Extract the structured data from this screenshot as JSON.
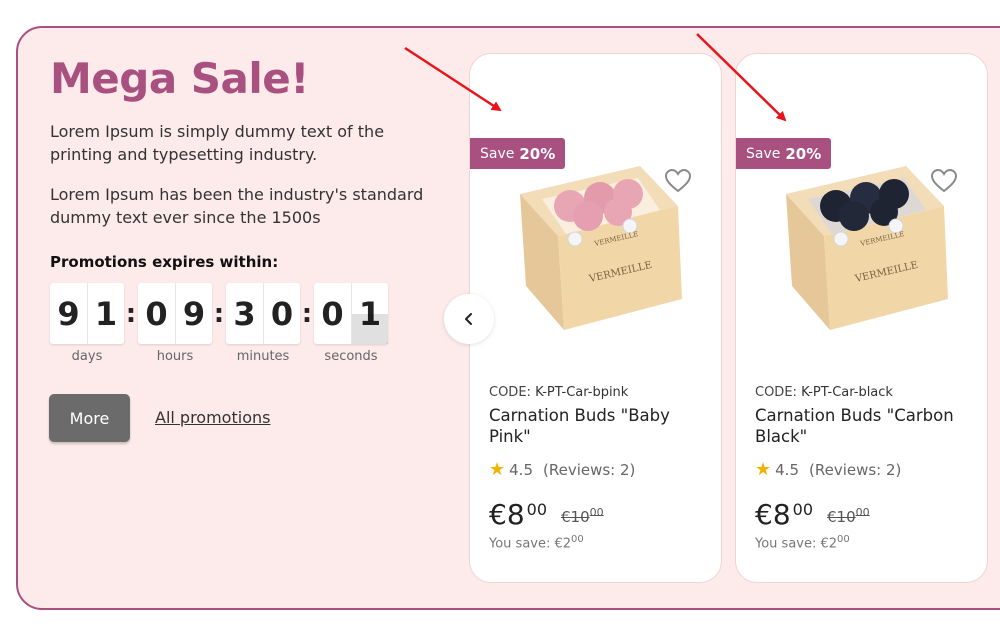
{
  "promo": {
    "title": "Mega Sale!",
    "para1": "Lorem Ipsum is simply dummy text of the printing and typesetting industry.",
    "para2": "Lorem Ipsum has been the industry's standard dummy text ever since the 1500s",
    "expires_label": "Promotions expires within:",
    "countdown": {
      "days": [
        "9",
        "1"
      ],
      "hours": [
        "0",
        "9"
      ],
      "minutes": [
        "3",
        "0"
      ],
      "seconds": [
        "0",
        "1"
      ],
      "separator": ":",
      "labels": {
        "days": "days",
        "hours": "hours",
        "minutes": "minutes",
        "seconds": "seconds"
      }
    },
    "more_label": "More",
    "all_label": "All promotions"
  },
  "carousel": {
    "prev_icon": "chevron-left-icon"
  },
  "products": [
    {
      "save_prefix": "Save",
      "save_value": "20%",
      "code_label": "CODE:",
      "code": "K-PT-Car-bpink",
      "name": "Carnation Buds \"Baby Pink\"",
      "rating": "4.5",
      "reviews": "(Reviews: 2)",
      "price_currency": "€",
      "price_int": "8",
      "price_dec": "00",
      "old_price_int": "€10",
      "old_price_dec": "00",
      "you_save_label": "You save: €2",
      "you_save_dec": "00",
      "image_color": "#e8a6b4",
      "image_brand": "VERMEILLE"
    },
    {
      "save_prefix": "Save",
      "save_value": "20%",
      "code_label": "CODE:",
      "code": "K-PT-Car-black",
      "name": "Carnation Buds \"Carbon Black\"",
      "rating": "4.5",
      "reviews": "(Reviews: 2)",
      "price_currency": "€",
      "price_int": "8",
      "price_dec": "00",
      "old_price_int": "€10",
      "old_price_dec": "00",
      "you_save_label": "You save: €2",
      "you_save_dec": "00",
      "image_color": "#1f2433",
      "image_brand": "VERMEILLE"
    }
  ],
  "colors": {
    "accent": "#a8507f",
    "background": "#fdeaea",
    "arrow": "#e8141b",
    "star": "#f0b400"
  }
}
